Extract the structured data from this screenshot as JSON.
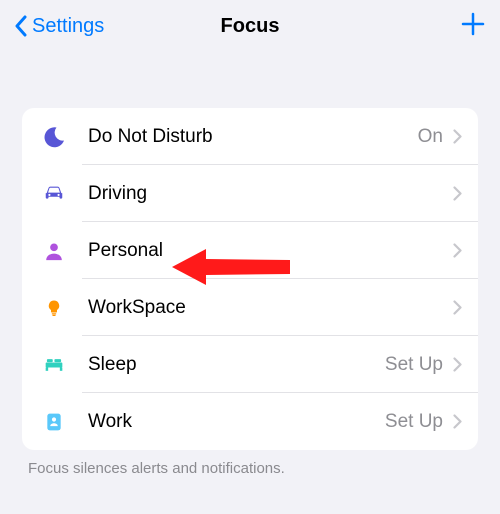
{
  "nav": {
    "back_label": "Settings",
    "title": "Focus"
  },
  "colors": {
    "moon": "#5856d6",
    "car": "#5856d6",
    "person": "#af52de",
    "bulb": "#ff9500",
    "bed": "#30d1bf",
    "badge": "#5ac8fa",
    "chevron": "#c7c7cc"
  },
  "items": [
    {
      "key": "dnd",
      "label": "Do Not Disturb",
      "status": "On"
    },
    {
      "key": "driving",
      "label": "Driving",
      "status": ""
    },
    {
      "key": "personal",
      "label": "Personal",
      "status": ""
    },
    {
      "key": "workspace",
      "label": "WorkSpace",
      "status": ""
    },
    {
      "key": "sleep",
      "label": "Sleep",
      "status": "Set Up"
    },
    {
      "key": "work",
      "label": "Work",
      "status": "Set Up"
    }
  ],
  "footer": "Focus silences alerts and notifications."
}
